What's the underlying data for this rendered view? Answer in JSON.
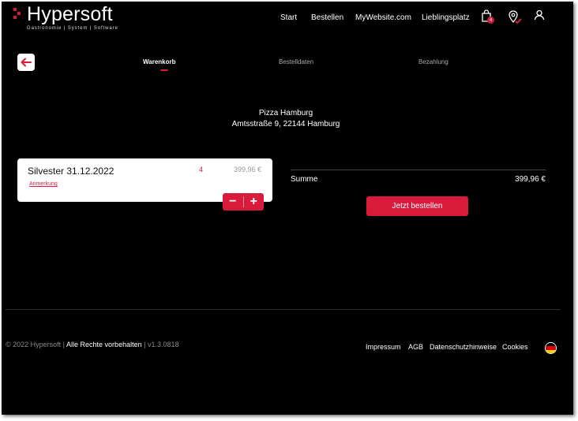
{
  "brand": {
    "name": "Hypersoft",
    "tagline": "Gastronomie | System | Software",
    "accent_color": "#d81b3a"
  },
  "header": {
    "nav": [
      "Start",
      "Bestellen",
      "MyWebsite.com",
      "Lieblingsplatz"
    ],
    "cart_icon": "shopping-bag-icon",
    "cart_count": "4",
    "location_icon": "map-pin-check-icon",
    "user_icon": "user-icon"
  },
  "steps": {
    "back_icon": "arrow-left-icon",
    "items": [
      "Warenkorb",
      "Bestelldaten",
      "Bezahlung"
    ],
    "active": "Warenkorb"
  },
  "restaurant": {
    "name": "Pizza Hamburg",
    "address": "Amtsstraße 9, 22144 Hamburg"
  },
  "cart": {
    "item": {
      "name": "Silvester 31.12.2022",
      "quantity": "4",
      "price": "399,96 €",
      "note_label": "Anmerkung"
    },
    "minus_label": "−",
    "plus_label": "+"
  },
  "summary": {
    "label": "Summe",
    "value": "399,96 €",
    "order_button": "Jetzt bestellen"
  },
  "footer": {
    "copyright": "© 2022 Hypersoft |",
    "rights": "Alle Rechte vorbehalten",
    "version": "| v1.3.0818",
    "links": [
      "Impressum",
      "AGB",
      "Datenschutzhinweise",
      "Cookies"
    ],
    "language_flag": "german-flag-icon"
  }
}
